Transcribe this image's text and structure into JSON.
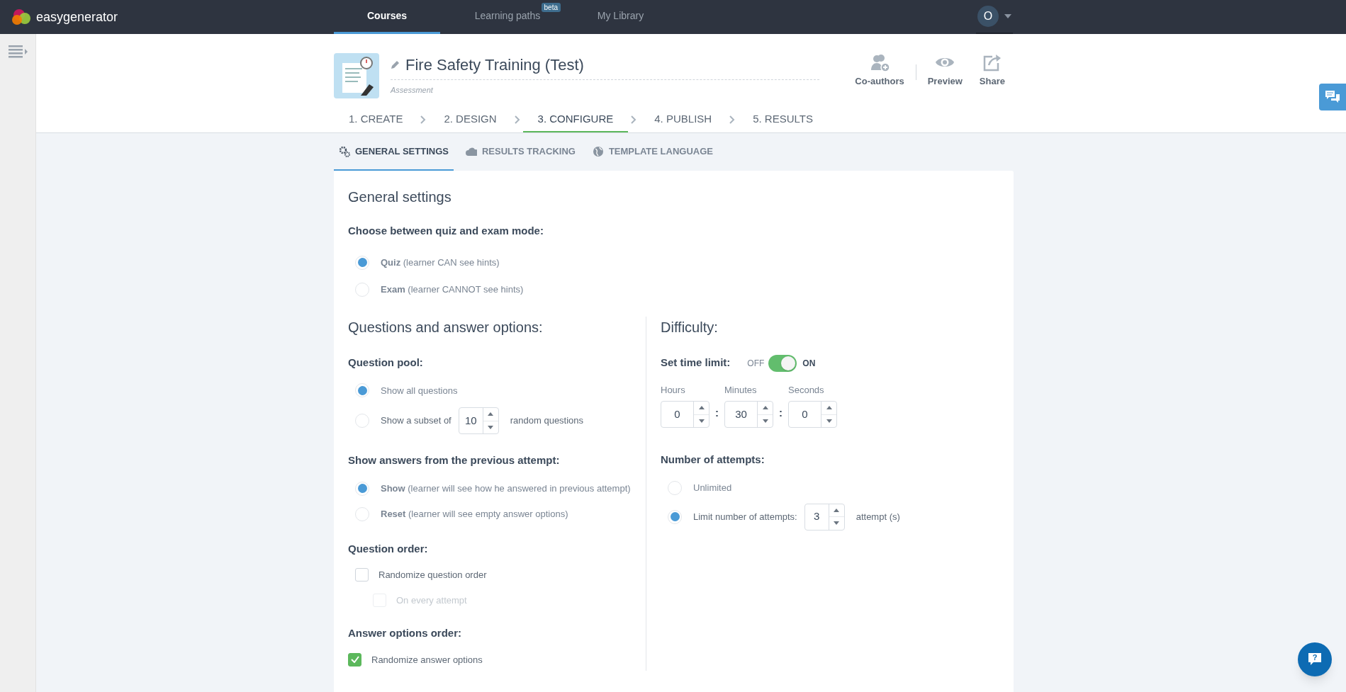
{
  "top_nav": {
    "logo": "easygenerator",
    "avatar": "O",
    "tabs": [
      {
        "label": "Courses",
        "selected": true
      },
      {
        "label": "Learning paths",
        "selected": false,
        "badge": "beta"
      },
      {
        "label": "My Library",
        "selected": false
      }
    ]
  },
  "help": {
    "label": "?"
  },
  "course": {
    "title": "Fire Safety Training (Test)",
    "subtitle": "Assessment"
  },
  "actions": [
    {
      "kind": "coauthors",
      "label": "Co-authors"
    },
    {
      "kind": "preview",
      "label": "Preview"
    },
    {
      "kind": "share",
      "label": "Share"
    }
  ],
  "steps": [
    {
      "label": "1. CREATE",
      "selected": false
    },
    {
      "label": "2. DESIGN",
      "selected": false
    },
    {
      "label": "3. CONFIGURE",
      "selected": true
    },
    {
      "label": "4. PUBLISH",
      "selected": false
    },
    {
      "label": "5. RESULTS",
      "selected": false
    }
  ],
  "subtabs": [
    {
      "kind": "gears",
      "label": "GENERAL SETTINGS",
      "selected": true
    },
    {
      "kind": "cloud",
      "label": "RESULTS TRACKING",
      "selected": false
    },
    {
      "kind": "globe",
      "label": "TEMPLATE LANGUAGE",
      "selected": false
    }
  ],
  "settings": {
    "title": "General settings",
    "mode": {
      "label": "Choose between quiz and exam mode:",
      "options": [
        {
          "kind": "plain",
          "text": "**Quiz** (learner CAN see hints)",
          "selected": true
        },
        {
          "kind": "plain",
          "text": "**Exam** (learner CANNOT see hints)",
          "selected": false
        }
      ]
    }
  },
  "questions": {
    "title": "Questions and answer options:",
    "sections": [
      {
        "kind": "radios",
        "label": "Question pool:",
        "options": [
          {
            "kind": "plain",
            "text": "Show all questions",
            "selected": true
          },
          {
            "kind": "number",
            "text": "Show a subset of",
            "value": "10",
            "suffix": "random questions",
            "selected": false
          }
        ]
      },
      {
        "kind": "radios",
        "label": "Show answers from the previous attempt:",
        "options": [
          {
            "kind": "plain",
            "text": "**Show** (learner will see how he answered in previous attempt)",
            "selected": true
          },
          {
            "kind": "plain",
            "text": "**Reset** (learner will see empty answer options)",
            "selected": false
          }
        ]
      },
      {
        "kind": "checkboxes",
        "label": "Question order:",
        "items": [
          {
            "label": "Randomize question order",
            "checked": false,
            "disabled": false,
            "children": [
              {
                "label": "On every attempt",
                "checked": false,
                "disabled": true
              }
            ]
          }
        ]
      },
      {
        "kind": "checkboxes",
        "label": "Answer options order:",
        "items": [
          {
            "label": "Randomize answer options",
            "checked": true,
            "disabled": false
          }
        ]
      }
    ]
  },
  "difficulty": {
    "title": "Difficulty:",
    "time_limit": {
      "label": "Set time limit:",
      "off_label": "OFF",
      "on_label": "ON",
      "on": true,
      "fields": [
        {
          "label": "Hours",
          "value": "0"
        },
        {
          "label": "Minutes",
          "value": "30"
        },
        {
          "label": "Seconds",
          "value": "0"
        }
      ],
      "separator": ":"
    },
    "attempts": {
      "label": "Number of attempts:",
      "options": [
        {
          "kind": "plain",
          "text": "Unlimited",
          "selected": false
        },
        {
          "kind": "number",
          "text": "Limit number of attempts:",
          "value": "3",
          "suffix": "attempt (s)",
          "selected": true
        }
      ]
    }
  }
}
